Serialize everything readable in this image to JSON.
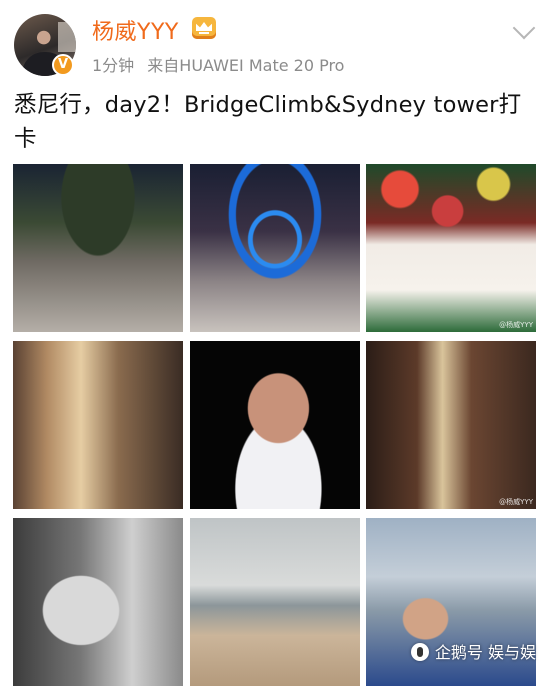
{
  "header": {
    "username": "杨威YYY",
    "time": "1分钟",
    "source": "来自HUAWEI Mate 20 Pro",
    "avatar_icon": "avatar-photo",
    "verified_icon": "verified-badge-icon",
    "vip_icon": "vip-crown-icon"
  },
  "post": {
    "text": "悉尼行，day2！BridgeClimb&Sydney tower打卡"
  },
  "photos": [
    {
      "watermark": ""
    },
    {
      "watermark": ""
    },
    {
      "watermark": "@杨威YYY"
    },
    {
      "watermark": ""
    },
    {
      "watermark": ""
    },
    {
      "watermark": "@杨威YYY"
    },
    {
      "watermark": ""
    },
    {
      "watermark": ""
    },
    {
      "watermark": ""
    }
  ],
  "footer": {
    "watermark_text": "企鹅号 娱与娱",
    "watermark_icon": "penguin-icon"
  },
  "colors": {
    "username": "#f06a1b",
    "meta": "#8b8b8b",
    "badge": "#f29a1f"
  }
}
